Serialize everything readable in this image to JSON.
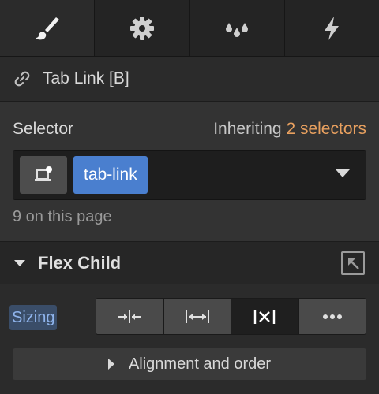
{
  "tabs": [
    {
      "name": "style",
      "icon": "paintbrush-icon",
      "active": true
    },
    {
      "name": "settings",
      "icon": "gear-icon",
      "active": false
    },
    {
      "name": "interactions",
      "icon": "drops-icon",
      "active": false
    },
    {
      "name": "ecommerce",
      "icon": "lightning-icon",
      "active": false
    }
  ],
  "element": {
    "icon": "link-icon",
    "title": "Tab Link [B]"
  },
  "selector": {
    "label": "Selector",
    "inheriting_text": "Inheriting",
    "inheriting_count": "2 selectors",
    "token": "tab-link",
    "on_page": "9 on this page",
    "colors": {
      "token": "#4a7fcf",
      "inherit_link": "#e8a05f"
    }
  },
  "section": {
    "title": "Flex Child"
  },
  "sizing": {
    "label": "Sizing",
    "options": [
      {
        "name": "shrink",
        "icon": "shrink-icon",
        "active": false
      },
      {
        "name": "grow",
        "icon": "grow-icon",
        "active": false
      },
      {
        "name": "none",
        "icon": "no-shrink-grow-icon",
        "active": true
      },
      {
        "name": "more",
        "icon": "more-icon",
        "active": false
      }
    ],
    "alignment_label": "Alignment and order"
  }
}
